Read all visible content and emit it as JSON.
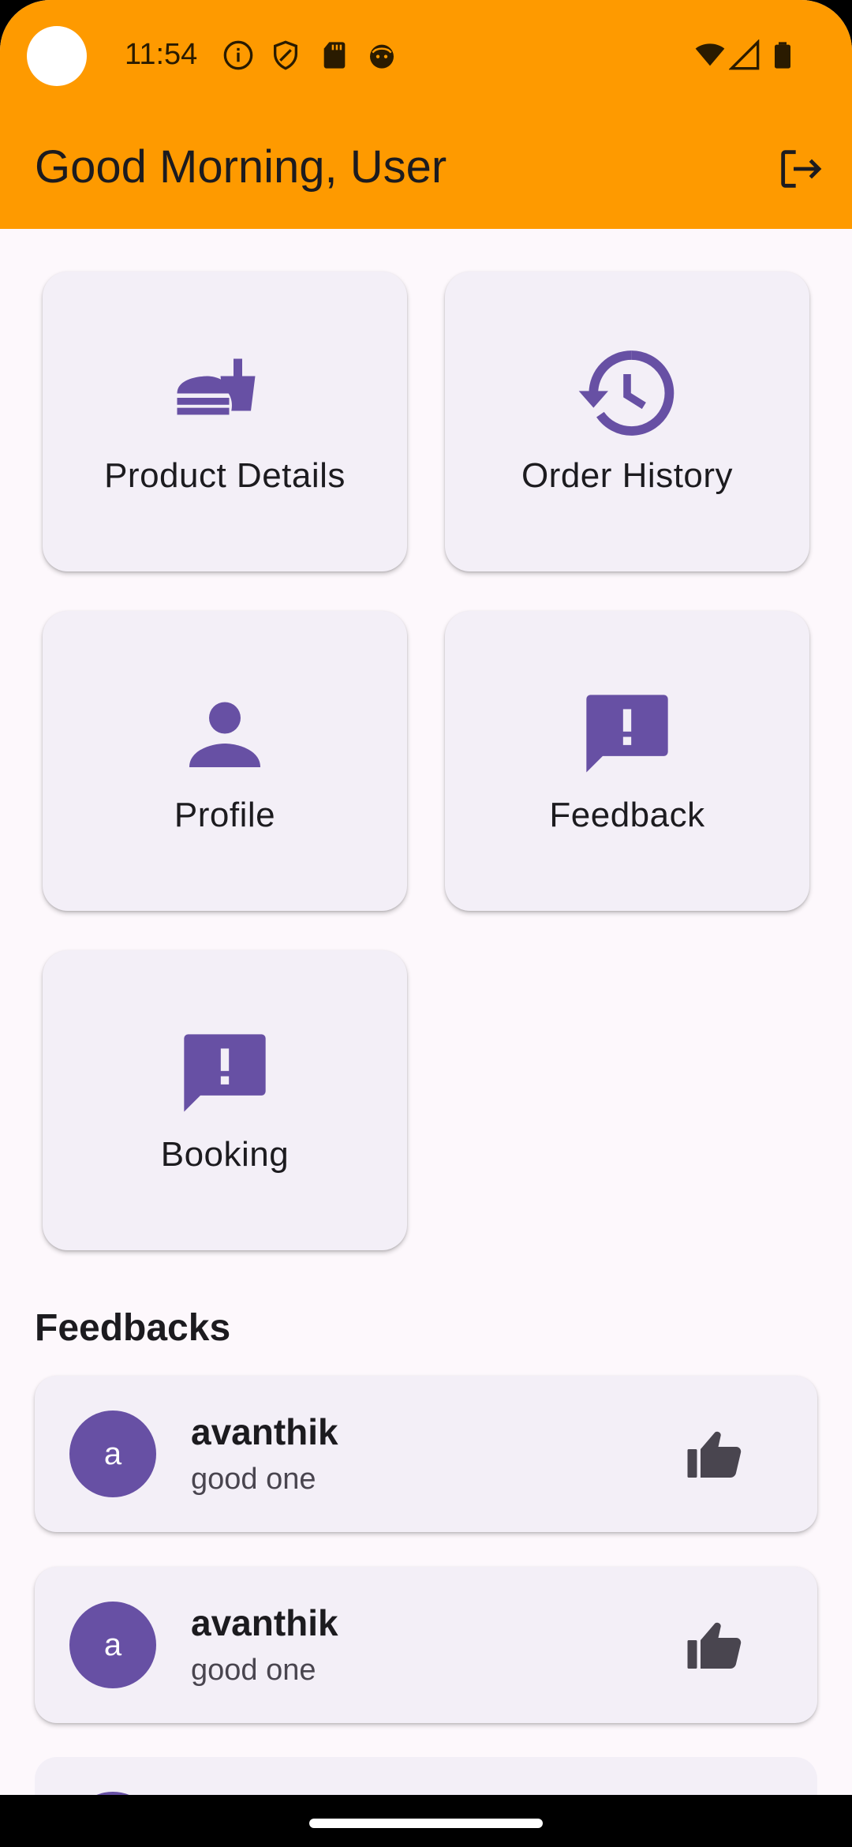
{
  "status_bar": {
    "time": "11:54"
  },
  "header": {
    "title": "Good Morning, User"
  },
  "menu": [
    {
      "label": "Product Details",
      "icon": "fastfood-icon"
    },
    {
      "label": "Order History",
      "icon": "history-icon"
    },
    {
      "label": "Profile",
      "icon": "person-icon"
    },
    {
      "label": "Feedback",
      "icon": "feedback-icon"
    },
    {
      "label": "Booking",
      "icon": "feedback-icon"
    }
  ],
  "feedbacks": {
    "title": "Feedbacks",
    "items": [
      {
        "initial": "a",
        "name": "avanthik",
        "message": "good one",
        "icon": "thumb-up-icon"
      },
      {
        "initial": "a",
        "name": "avanthik",
        "message": "good one",
        "icon": "thumb-up-icon"
      }
    ]
  },
  "colors": {
    "accent": "#fe9a00",
    "primary": "#6750a4",
    "surface": "#f3eff7"
  }
}
